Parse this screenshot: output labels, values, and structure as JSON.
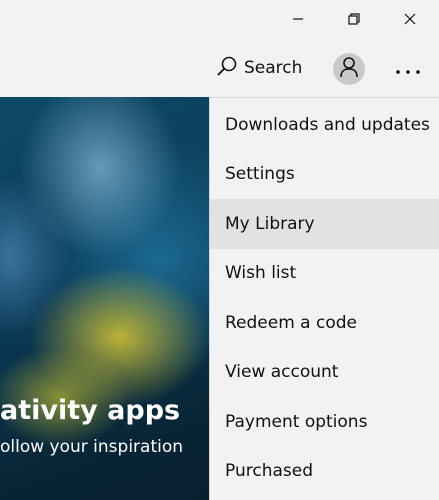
{
  "window_controls": {
    "minimize_icon": "minimize-icon",
    "restore_icon": "restore-icon",
    "close_icon": "close-icon"
  },
  "toolbar": {
    "search_label": "Search",
    "search_icon": "search-icon",
    "avatar_icon": "person-icon",
    "more_icon": "more-icon"
  },
  "hero": {
    "title": "ativity apps",
    "subtitle": "ollow your inspiration"
  },
  "menu": {
    "items": [
      {
        "label": "Downloads and updates"
      },
      {
        "label": "Settings"
      },
      {
        "label": "My Library"
      },
      {
        "label": "Wish list"
      },
      {
        "label": "Redeem a code"
      },
      {
        "label": "View account"
      },
      {
        "label": "Payment options"
      },
      {
        "label": "Purchased"
      }
    ],
    "active_index": 2
  },
  "colors": {
    "chrome_bg": "#f2f2f2",
    "menu_hover_bg": "#e2e2e2",
    "hero_text": "#ffffff"
  }
}
